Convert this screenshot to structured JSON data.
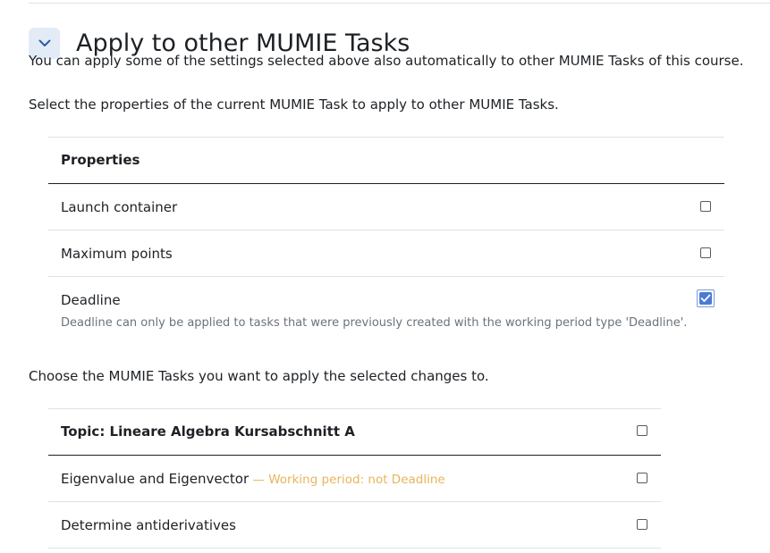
{
  "section": {
    "title": "Apply to other MUMIE Tasks",
    "intro": "You can apply some of the settings selected above also automatically to other MUMIE Tasks of this course.",
    "select_props_text": "Select the properties of the current MUMIE Task to apply to other MUMIE Tasks.",
    "choose_tasks_text": "Choose the MUMIE Tasks you want to apply the selected changes to."
  },
  "properties_table": {
    "header": "Properties",
    "rows": [
      {
        "label": "Launch container",
        "checked": false
      },
      {
        "label": "Maximum points",
        "checked": false
      },
      {
        "label": "Deadline",
        "checked": true,
        "hint": "Deadline can only be applied to tasks that were previously created with the working period type 'Deadline'."
      }
    ]
  },
  "tasks_table": {
    "header": "Topic: Lineare Algebra Kursabschnitt A",
    "header_checked": false,
    "rows": [
      {
        "label": "Eigenvalue and Eigenvector",
        "note": " — Working period: not Deadline",
        "checked": false
      },
      {
        "label": "Determine antiderivatives",
        "note": "",
        "checked": false
      }
    ]
  },
  "colors": {
    "accent": "#4a7ad4",
    "warning_note": "#e8b45d",
    "collapse_bg": "#e3ebf7"
  },
  "icons": {
    "collapse": "chevron-down-icon",
    "check": "checkmark-icon"
  }
}
